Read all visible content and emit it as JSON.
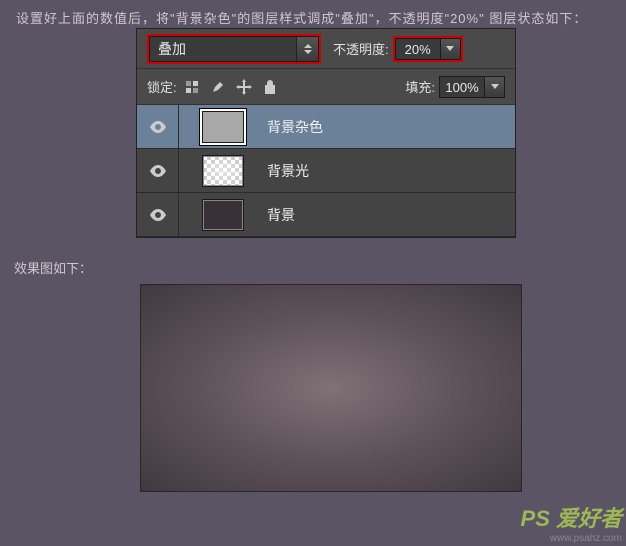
{
  "instruction_text": "设置好上面的数值后，将\"背景杂色\"的图层样式调成\"叠加\"，不透明度\"20%\" 图层状态如下：",
  "blend_mode": {
    "selected": "叠加"
  },
  "opacity": {
    "label": "不透明度:",
    "value": "20%"
  },
  "lock": {
    "label": "锁定:"
  },
  "fill": {
    "label": "填充:",
    "value": "100%"
  },
  "layers": [
    {
      "name": "背景杂色",
      "selected": true,
      "thumb": "gray"
    },
    {
      "name": "背景光",
      "selected": false,
      "thumb": "checker"
    },
    {
      "name": "背景",
      "selected": false,
      "thumb": "solid"
    }
  ],
  "result_label": "效果图如下：",
  "watermark": {
    "main": "PS 爱好者",
    "sub": "www.psahz.com"
  }
}
